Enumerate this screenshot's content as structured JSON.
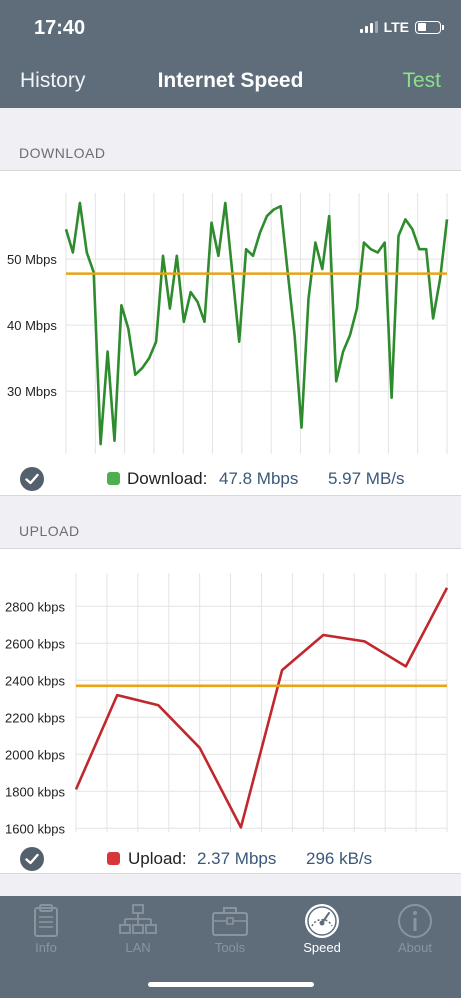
{
  "status": {
    "time": "17:40",
    "network": "LTE"
  },
  "nav": {
    "left": "History",
    "title": "Internet Speed",
    "right": "Test"
  },
  "download": {
    "header": "DOWNLOAD",
    "legend_label": "Download:",
    "speed": "47.8 Mbps",
    "bytes": "5.97 MB/s",
    "color": "#2e8b2e",
    "swatch_color": "#4caf50"
  },
  "upload": {
    "header": "UPLOAD",
    "legend_label": "Upload:",
    "speed": "2.37 Mbps",
    "bytes": "296 kB/s",
    "color": "#c0282d",
    "swatch_color": "#d9363b"
  },
  "average_line_color": "#e8a317",
  "chart_data": [
    {
      "type": "line",
      "series": [
        {
          "values": [
            54.5,
            51,
            58.5,
            51,
            48,
            22,
            36,
            22.5,
            43,
            39.5,
            32.5,
            33.5,
            35,
            37.5,
            50.5,
            42.5,
            50.5,
            40.5,
            45,
            43.5,
            40.5,
            55.5,
            50.5,
            58.5,
            48,
            37.5,
            51.5,
            50.5,
            54,
            56.5,
            57.5,
            58,
            48,
            38.5,
            24.5,
            44,
            52.5,
            48.5,
            56.5,
            31.5,
            36,
            38.5,
            42.5,
            52.5,
            51.5,
            51,
            52.5,
            29,
            53.5,
            56,
            54.5,
            51.5,
            51.5,
            41,
            47,
            56
          ]
        }
      ],
      "average": 47.8,
      "y_ticks": [
        {
          "value": 30,
          "label": "30 Mbps"
        },
        {
          "value": 40,
          "label": "40 Mbps"
        },
        {
          "value": 50,
          "label": "50 Mbps"
        }
      ],
      "ylim": [
        20.5,
        60
      ],
      "grid": true
    },
    {
      "type": "line",
      "series": [
        {
          "values": [
            1810,
            2320,
            2265,
            2035,
            1605,
            2455,
            2645,
            2610,
            2475,
            2900
          ]
        }
      ],
      "average": 2370,
      "y_ticks": [
        {
          "value": 1600,
          "label": "1600 kbps"
        },
        {
          "value": 1800,
          "label": "1800 kbps"
        },
        {
          "value": 2000,
          "label": "2000 kbps"
        },
        {
          "value": 2200,
          "label": "2200 kbps"
        },
        {
          "value": 2400,
          "label": "2400 kbps"
        },
        {
          "value": 2600,
          "label": "2600 kbps"
        },
        {
          "value": 2800,
          "label": "2800 kbps"
        }
      ],
      "ylim": [
        1580,
        2980
      ],
      "grid": true
    }
  ],
  "tabs": [
    {
      "label": "Info",
      "icon": "document-icon",
      "active": false
    },
    {
      "label": "LAN",
      "icon": "network-icon",
      "active": false
    },
    {
      "label": "Tools",
      "icon": "toolbox-icon",
      "active": false
    },
    {
      "label": "Speed",
      "icon": "speedometer-icon",
      "active": true
    },
    {
      "label": "About",
      "icon": "info-icon",
      "active": false
    }
  ]
}
